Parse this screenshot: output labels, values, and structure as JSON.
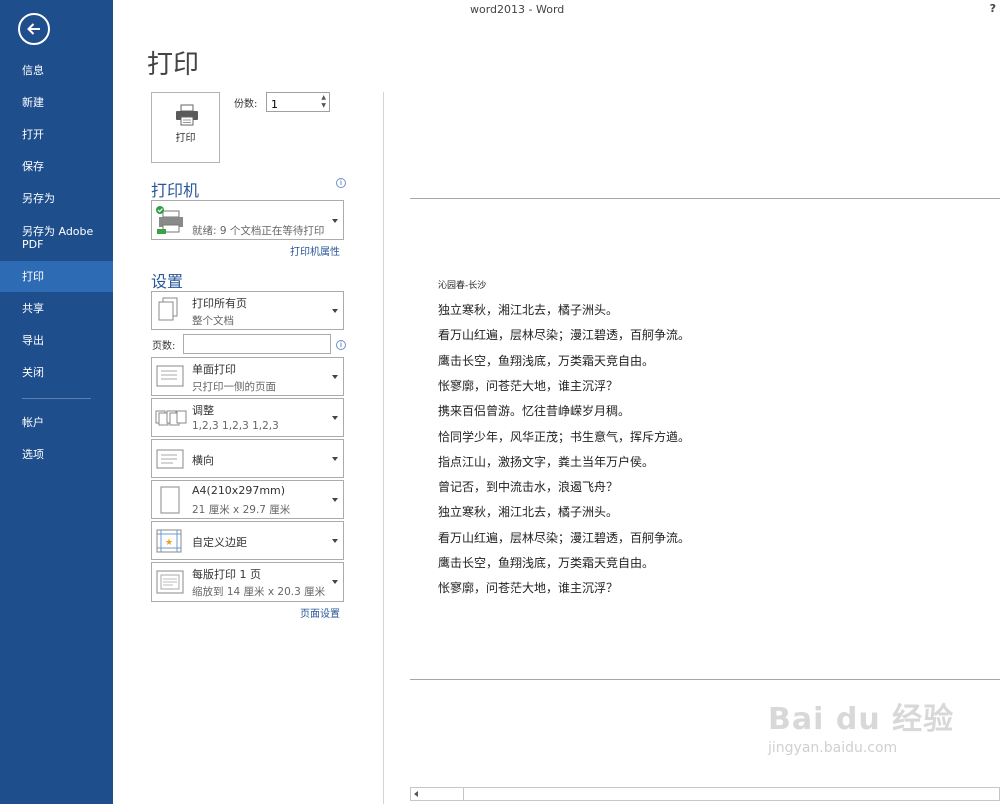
{
  "window": {
    "title": "word2013 - Word",
    "help": "?"
  },
  "sidebar": {
    "items": [
      {
        "label": "信息"
      },
      {
        "label": "新建"
      },
      {
        "label": "打开"
      },
      {
        "label": "保存"
      },
      {
        "label": "另存为"
      },
      {
        "label": "另存为 Adobe PDF"
      },
      {
        "label": "打印",
        "active": true
      },
      {
        "label": "共享"
      },
      {
        "label": "导出"
      },
      {
        "label": "关闭"
      },
      {
        "label": "帐户"
      },
      {
        "label": "选项"
      }
    ]
  },
  "page": {
    "heading": "打印"
  },
  "print": {
    "button_label": "打印",
    "copies_label": "份数:",
    "copies_value": "1"
  },
  "printer": {
    "section_title": "打印机",
    "status": "就绪: 9 个文档正在等待打印",
    "properties_link": "打印机属性"
  },
  "settings": {
    "section_title": "设置",
    "pages_label": "页数:",
    "pages_value": "",
    "page_setup_link": "页面设置",
    "options": [
      {
        "title": "打印所有页",
        "subtitle": "整个文档",
        "icon": "pages-icon"
      },
      {
        "title": "单面打印",
        "subtitle": "只打印一侧的页面",
        "icon": "one-sided-icon"
      },
      {
        "title": "调整",
        "subtitle": "1,2,3    1,2,3    1,2,3",
        "icon": "collate-icon"
      },
      {
        "title": "横向",
        "subtitle": "",
        "icon": "orientation-icon"
      },
      {
        "title": "A4(210x297mm)",
        "subtitle": "21 厘米 x 29.7 厘米",
        "icon": "paper-size-icon"
      },
      {
        "title": "自定义边距",
        "subtitle": "",
        "icon": "margins-icon"
      },
      {
        "title": "每版打印 1 页",
        "subtitle": "缩放到 14 厘米 x 20.3 厘米",
        "icon": "pages-per-sheet-icon"
      }
    ]
  },
  "preview": {
    "doc_title": "沁园春-长沙",
    "lines": [
      "独立寒秋，湘江北去，橘子洲头。",
      "看万山红遍，层林尽染；漫江碧透，百舸争流。",
      "鹰击长空，鱼翔浅底，万类霜天竞自由。",
      "怅寥廓，问苍茫大地，谁主沉浮？",
      "携来百侣曾游。忆往昔峥嵘岁月稠。",
      "恰同学少年，风华正茂；书生意气，挥斥方遒。",
      "指点江山，激扬文字，粪土当年万户侯。",
      "曾记否，到中流击水，浪遏飞舟？",
      "独立寒秋，湘江北去，橘子洲头。",
      "看万山红遍，层林尽染；漫江碧透，百舸争流。",
      "鹰击长空，鱼翔浅底，万类霜天竞自由。",
      "怅寥廓，问苍茫大地，谁主沉浮？"
    ]
  },
  "watermark": {
    "brand": "Bai du 经验",
    "url": "jingyan.baidu.com"
  }
}
